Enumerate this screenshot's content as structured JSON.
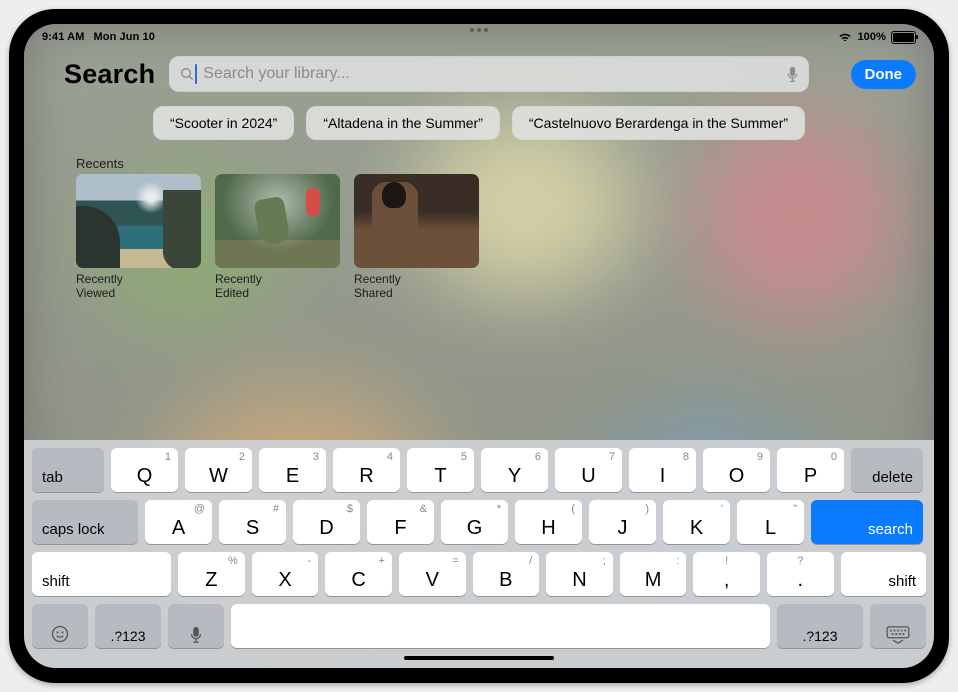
{
  "status": {
    "time": "9:41 AM",
    "date": "Mon Jun 10",
    "battery": "100%"
  },
  "header": {
    "title": "Search",
    "done": "Done"
  },
  "search": {
    "placeholder": "Search your library..."
  },
  "suggestions": [
    "“Scooter in 2024”",
    "“Altadena in the Summer”",
    "“Castelnuovo Berardenga in the Summer”"
  ],
  "recents": {
    "header": "Recents",
    "items": [
      "Recently\nViewed",
      "Recently\nEdited",
      "Recently\nShared"
    ]
  },
  "keyboard": {
    "row1": [
      {
        "k": "Q",
        "s": "1"
      },
      {
        "k": "W",
        "s": "2"
      },
      {
        "k": "E",
        "s": "3"
      },
      {
        "k": "R",
        "s": "4"
      },
      {
        "k": "T",
        "s": "5"
      },
      {
        "k": "Y",
        "s": "6"
      },
      {
        "k": "U",
        "s": "7"
      },
      {
        "k": "I",
        "s": "8"
      },
      {
        "k": "O",
        "s": "9"
      },
      {
        "k": "P",
        "s": "0"
      }
    ],
    "row2": [
      {
        "k": "A",
        "s": "@"
      },
      {
        "k": "S",
        "s": "#"
      },
      {
        "k": "D",
        "s": "$"
      },
      {
        "k": "F",
        "s": "&"
      },
      {
        "k": "G",
        "s": "*"
      },
      {
        "k": "H",
        "s": "("
      },
      {
        "k": "J",
        "s": ")"
      },
      {
        "k": "K",
        "s": "'"
      },
      {
        "k": "L",
        "s": "\""
      }
    ],
    "row3": [
      {
        "k": "Z",
        "s": "%"
      },
      {
        "k": "X",
        "s": "-"
      },
      {
        "k": "C",
        "s": "+"
      },
      {
        "k": "V",
        "s": "="
      },
      {
        "k": "B",
        "s": "/"
      },
      {
        "k": "N",
        "s": ";"
      },
      {
        "k": "M",
        "s": ":"
      },
      {
        "k": ",",
        "s": "!"
      },
      {
        "k": ".",
        "s": "?"
      }
    ],
    "tab": "tab",
    "caps": "caps lock",
    "delete": "delete",
    "search": "search",
    "shift": "shift",
    "numSym": ".?123"
  }
}
